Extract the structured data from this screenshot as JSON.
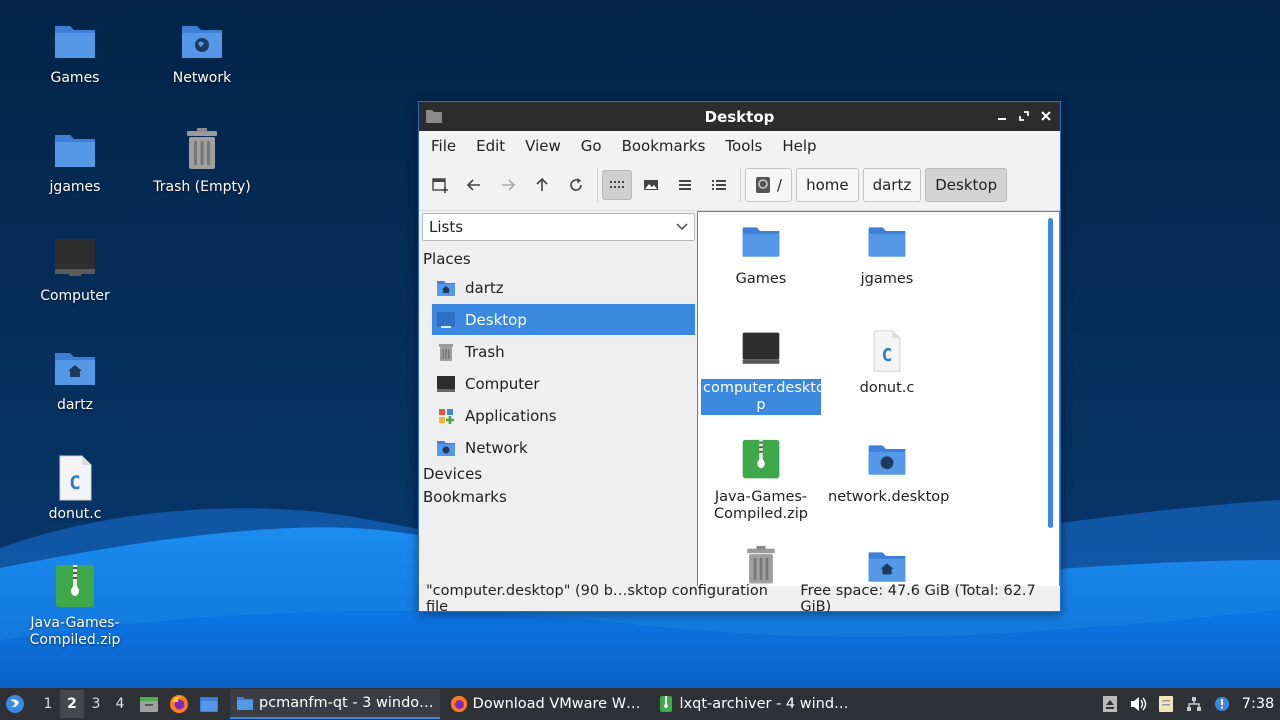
{
  "desktop": {
    "icons": [
      {
        "label": "Games",
        "icon": "folder-icon"
      },
      {
        "label": "Network",
        "icon": "network-folder-icon"
      },
      {
        "label": "jgames",
        "icon": "folder-icon"
      },
      {
        "label": "Trash (Empty)",
        "icon": "trash-icon"
      },
      {
        "label": "Computer",
        "icon": "computer-icon"
      },
      {
        "label": "dartz",
        "icon": "home-folder-icon"
      },
      {
        "label": "donut.c",
        "icon": "c-source-file-icon"
      },
      {
        "label": "Java-Games-\nCompiled.zip",
        "icon": "zip-archive-icon"
      }
    ]
  },
  "window": {
    "title": "Desktop",
    "menu": [
      "File",
      "Edit",
      "View",
      "Go",
      "Bookmarks",
      "Tools",
      "Help"
    ],
    "toolbar": {
      "buttons": [
        "new-tab-icon",
        "back-icon",
        "forward-icon",
        "up-icon",
        "reload-icon",
        "icon-view-icon",
        "thumbnail-view-icon",
        "compact-view-icon",
        "detailed-list-icon"
      ],
      "active_view": "icon-view-icon"
    },
    "breadcrumb": {
      "root": "/",
      "parts": [
        "home",
        "dartz"
      ],
      "current": "Desktop"
    },
    "sidepane": {
      "mode": "Lists",
      "places_header": "Places",
      "places": [
        {
          "label": "dartz",
          "icon": "home-folder-icon"
        },
        {
          "label": "Desktop",
          "icon": "desktop-icon",
          "selected": true
        },
        {
          "label": "Trash",
          "icon": "trash-icon"
        },
        {
          "label": "Computer",
          "icon": "computer-icon"
        },
        {
          "label": "Applications",
          "icon": "applications-icon"
        },
        {
          "label": "Network",
          "icon": "network-folder-icon"
        }
      ],
      "devices_header": "Devices",
      "bookmarks_header": "Bookmarks"
    },
    "files": [
      {
        "name": "Games",
        "icon": "folder-icon"
      },
      {
        "name": "jgames",
        "icon": "folder-icon"
      },
      {
        "name": "computer.deskto\np",
        "icon": "computer-icon",
        "selected": true
      },
      {
        "name": "donut.c",
        "icon": "c-source-file-icon"
      },
      {
        "name": "Java-Games-\nCompiled.zip",
        "icon": "zip-archive-icon"
      },
      {
        "name": "network.desktop",
        "icon": "network-folder-icon"
      },
      {
        "name": "",
        "icon": "trash-icon"
      },
      {
        "name": "",
        "icon": "home-folder-icon"
      }
    ],
    "status": {
      "selection": "\"computer.desktop\" (90 b…sktop configuration file",
      "free_space": "Free space: 47.6 GiB (Total: 62.7 GiB)"
    }
  },
  "taskbar": {
    "desktops": [
      "1",
      "2",
      "3",
      "4"
    ],
    "current_desktop": "2",
    "tasks": [
      {
        "label": "pcmanfm-qt - 3 windo…",
        "icon": "file-manager-icon",
        "active": true
      },
      {
        "label": "Download VMware W…",
        "icon": "firefox-icon",
        "active": false
      },
      {
        "label": "lxqt-archiver - 4 wind…",
        "icon": "archiver-icon",
        "active": false
      }
    ],
    "clock": "7:38"
  },
  "colors": {
    "accent": "#3b88e0",
    "titlebar": "#2c2c2c",
    "taskbar": "#2e3136",
    "folder": "#4a8fe0",
    "zip": "#3fa84a"
  }
}
